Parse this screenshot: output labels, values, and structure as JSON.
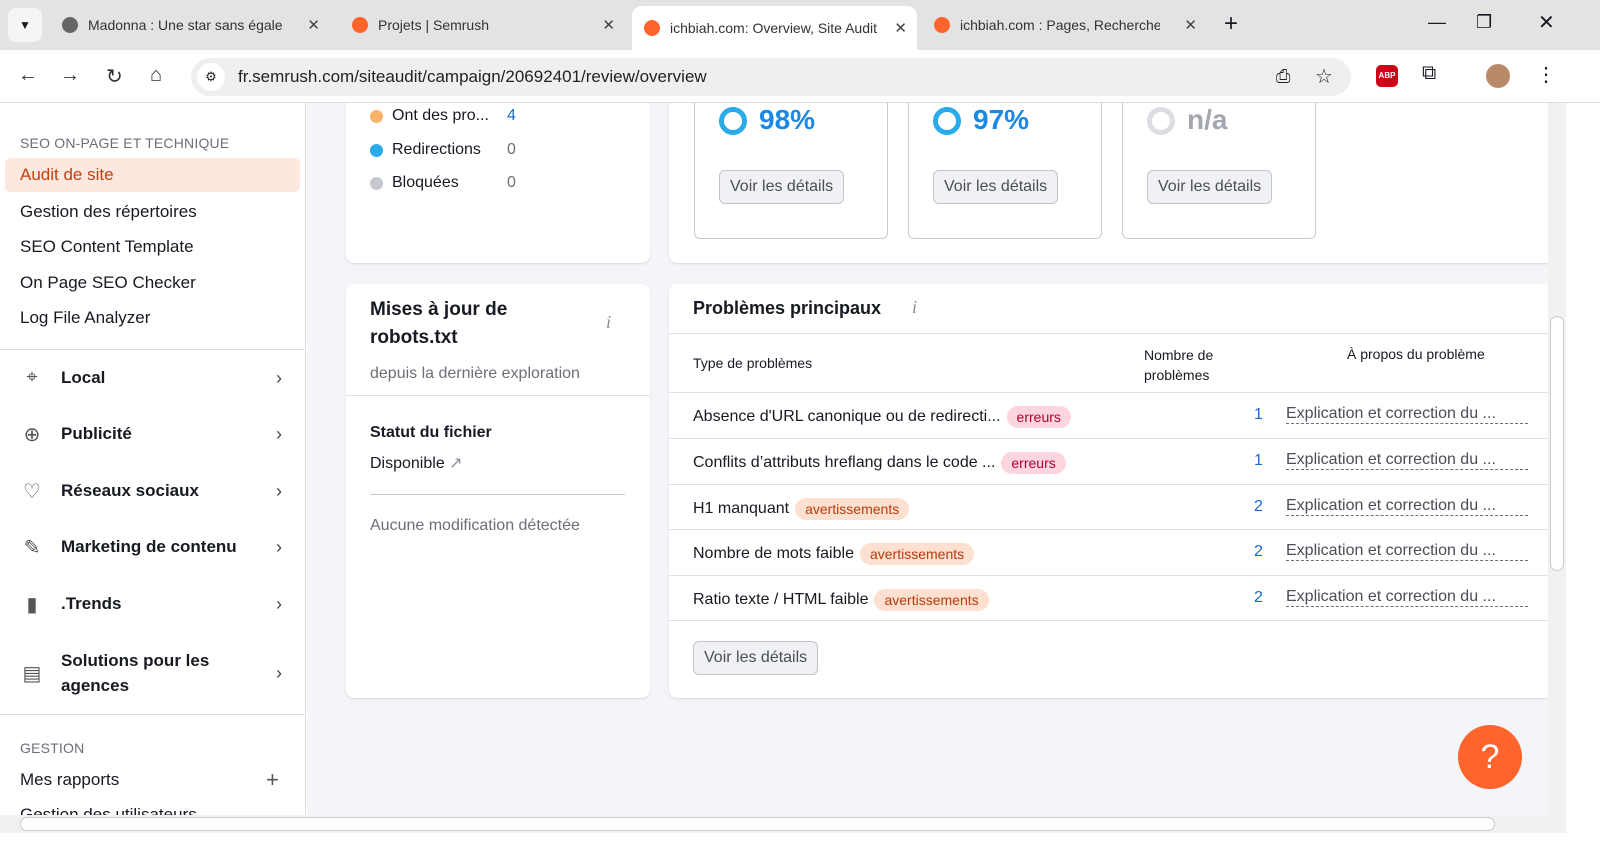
{
  "browser": {
    "tabs": [
      {
        "title": "Madonna : Une star sans égale"
      },
      {
        "title": "Projets | Semrush"
      },
      {
        "title": "ichbiah.com: Overview, Site Audit"
      },
      {
        "title": "ichbiah.com : Pages, Recherche"
      }
    ],
    "new_tab": "+",
    "url": "fr.semrush.com/siteaudit/campaign/20692401/review/overview",
    "abp": "ABP"
  },
  "sidebar": {
    "section1": "SEO ON-PAGE ET TECHNIQUE",
    "items": [
      "Audit de site",
      "Gestion des répertoires",
      "SEO Content Template",
      "On Page SEO Checker",
      "Log File Analyzer"
    ],
    "groups": [
      "Local",
      "Publicité",
      "Réseaux sociaux",
      "Marketing de contenu",
      ".Trends",
      "Solutions pour les agences"
    ],
    "section2": "GESTION",
    "items2": [
      "Mes rapports",
      "Gestion des utilisateurs"
    ],
    "add": "+"
  },
  "pages_card": {
    "legend": [
      {
        "label": "Ont des pro...",
        "value": "4",
        "color": "#f8b36a"
      },
      {
        "label": "Redirections",
        "value": "0",
        "color": "#2aaae9"
      },
      {
        "label": "Bloquées",
        "value": "0",
        "color": "#c6c8d0"
      }
    ]
  },
  "scores": [
    {
      "value": "98%",
      "active": true
    },
    {
      "value": "97%",
      "active": true
    },
    {
      "value": "n/a",
      "active": false
    }
  ],
  "details_label": "Voir les détails",
  "robots": {
    "title": "Mises à jour de robots.txt",
    "subtitle": "depuis la dernière exploration",
    "status_label": "Statut du fichier",
    "status_value": "Disponible",
    "changes": "Aucune modification détectée"
  },
  "issues": {
    "title": "Problèmes principaux",
    "headers": {
      "type": "Type de problèmes",
      "count": "Nombre de problèmes",
      "about": "À propos du problème"
    },
    "rows": [
      {
        "name": "Absence d'URL canonique ou de redirecti...",
        "badge": "erreurs",
        "count": "1",
        "link": "Explication et correction du ..."
      },
      {
        "name": "Conflits d’attributs hreflang dans le code ...",
        "badge": "erreurs",
        "count": "1",
        "link": "Explication et correction du ..."
      },
      {
        "name": "H1 manquant",
        "badge": "avertissements",
        "count": "2",
        "link": "Explication et correction du ..."
      },
      {
        "name": "Nombre de mots faible",
        "badge": "avertissements",
        "count": "2",
        "link": "Explication et correction du ..."
      },
      {
        "name": "Ratio texte / HTML faible",
        "badge": "avertissements",
        "count": "2",
        "link": "Explication et correction du ..."
      }
    ],
    "button": "Voir les détails"
  },
  "help": "?",
  "colors": {
    "accent": "#ff642d",
    "link": "#1b6ac9"
  }
}
